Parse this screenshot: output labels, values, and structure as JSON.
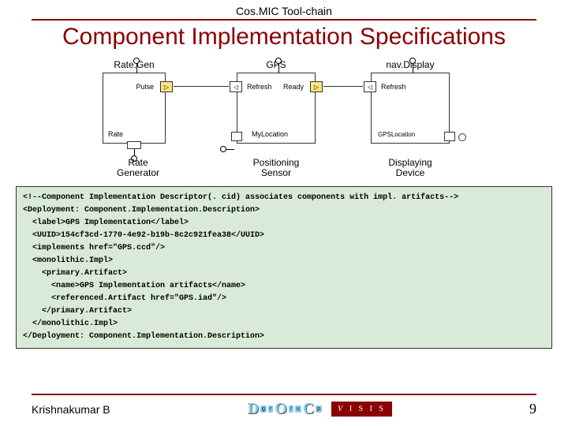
{
  "header": {
    "small": "Cos.MIC Tool-chain"
  },
  "title": "Component Implementation Specifications",
  "components": {
    "rate": {
      "name": "Rate.Gen",
      "port_pulse": "Pulse",
      "port_rate": "Rate",
      "caption_l1": "Rate",
      "caption_l2": "Generator"
    },
    "gps": {
      "name": "GPS",
      "port_refresh": "Refresh",
      "port_ready": "Ready",
      "port_myloc": "MyLocation",
      "caption_l1": "Positioning",
      "caption_l2": "Sensor"
    },
    "nav": {
      "name": "nav.Display",
      "port_refresh": "Refresh",
      "port_gpsloc": "GPSLocation",
      "caption_l1": "Displaying",
      "caption_l2": "Device"
    }
  },
  "code": {
    "l1": "<!--Component Implementation Descriptor(. cid) associates components with impl. artifacts-->",
    "l2": "<Deployment: Component.Implementation.Description>",
    "l3": "  <label>GPS Implementation</label>",
    "l4": "  <UUID>154cf3cd-1770-4e92-b19b-8c2c921fea38</UUID>",
    "l5": "  <implements href=\"GPS.ccd\"/>",
    "l6": "  <monolithic.Impl>",
    "l7": "    <primary.Artifact>",
    "l8": "      <name>GPS Implementation artifacts</name>",
    "l9": "      <referenced.Artifact href=\"GPS.iad\"/>",
    "l10": "    </primary.Artifact>",
    "l11": "  </monolithic.Impl>",
    "l12": "</Deployment: Component.Implementation.Description>"
  },
  "footer": {
    "author": "Krishnakumar B",
    "page": "9"
  },
  "logo_doc": {
    "d": "D",
    "g": "g",
    "r": "r",
    "o": "O",
    "slash": "/",
    "u": "u",
    "c": "C",
    "p": "p"
  },
  "logo_isis": {
    "text": "I S I S",
    "v": "V"
  }
}
